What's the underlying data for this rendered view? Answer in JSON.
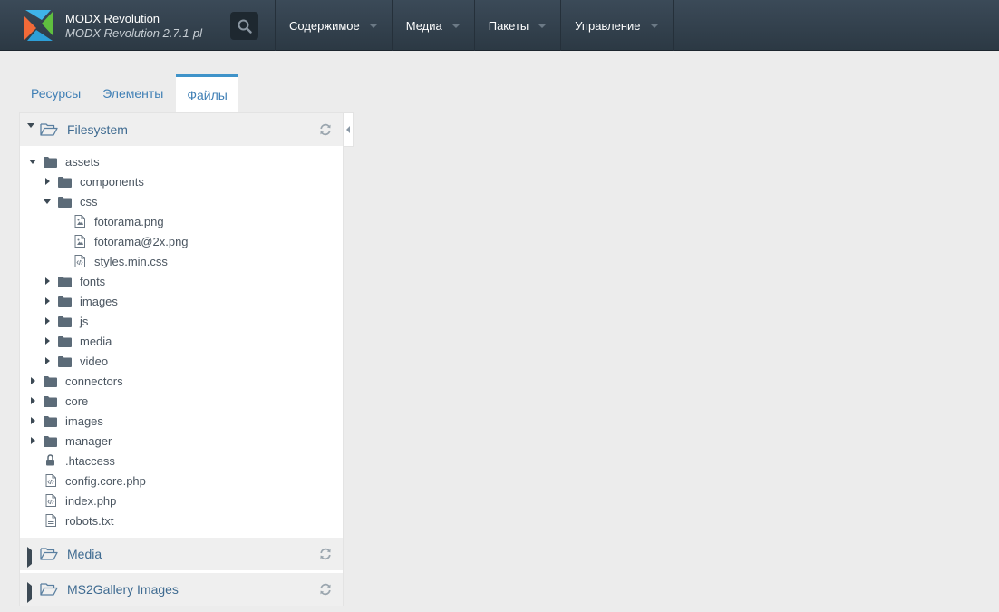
{
  "header": {
    "brand_name": "MODX Revolution",
    "brand_version": "MODX Revolution 2.7.1-pl",
    "nav": [
      {
        "label": "Содержимое"
      },
      {
        "label": "Медиа"
      },
      {
        "label": "Пакеты"
      },
      {
        "label": "Управление"
      }
    ]
  },
  "tabs": [
    {
      "label": "Ресурсы",
      "active": false
    },
    {
      "label": "Элементы",
      "active": false
    },
    {
      "label": "Файлы",
      "active": true
    }
  ],
  "sources": [
    {
      "label": "Filesystem",
      "expanded": true
    },
    {
      "label": "Media",
      "expanded": false
    },
    {
      "label": "MS2Gallery Images",
      "expanded": false
    }
  ],
  "tree": [
    {
      "label": "assets",
      "type": "folder",
      "depth": 0,
      "expanded": true
    },
    {
      "label": "components",
      "type": "folder",
      "depth": 1,
      "expanded": false
    },
    {
      "label": "css",
      "type": "folder",
      "depth": 1,
      "expanded": true
    },
    {
      "label": "fotorama.png",
      "type": "image",
      "depth": 2
    },
    {
      "label": "fotorama@2x.png",
      "type": "image",
      "depth": 2
    },
    {
      "label": "styles.min.css",
      "type": "code",
      "depth": 2
    },
    {
      "label": "fonts",
      "type": "folder",
      "depth": 1,
      "expanded": false
    },
    {
      "label": "images",
      "type": "folder",
      "depth": 1,
      "expanded": false
    },
    {
      "label": "js",
      "type": "folder",
      "depth": 1,
      "expanded": false
    },
    {
      "label": "media",
      "type": "folder",
      "depth": 1,
      "expanded": false
    },
    {
      "label": "video",
      "type": "folder",
      "depth": 1,
      "expanded": false
    },
    {
      "label": "connectors",
      "type": "folder",
      "depth": 0,
      "expanded": false
    },
    {
      "label": "core",
      "type": "folder",
      "depth": 0,
      "expanded": false
    },
    {
      "label": "images",
      "type": "folder",
      "depth": 0,
      "expanded": false
    },
    {
      "label": "manager",
      "type": "folder",
      "depth": 0,
      "expanded": false
    },
    {
      "label": ".htaccess",
      "type": "lock",
      "depth": 0
    },
    {
      "label": "config.core.php",
      "type": "code",
      "depth": 0
    },
    {
      "label": "index.php",
      "type": "code",
      "depth": 0
    },
    {
      "label": "robots.txt",
      "type": "text",
      "depth": 0
    }
  ],
  "colors": {
    "accent": "#3f93c9",
    "link": "#3f7fb5",
    "topbar": "#33414d",
    "folder": "#5c6b78"
  }
}
